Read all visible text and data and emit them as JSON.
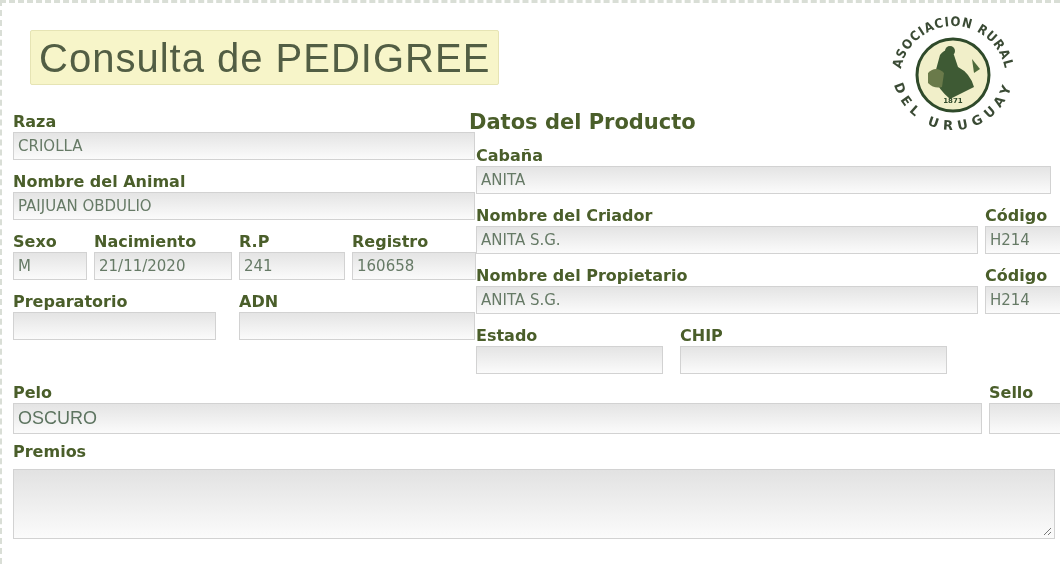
{
  "title": "Consulta de PEDIGREE",
  "logo": {
    "top_text": "ASOCIACION RURAL",
    "bottom_text": "DEL URUGUAY",
    "year": "1871"
  },
  "left_fields": [
    {
      "label": "Raza",
      "value": "CRIOLLA"
    },
    {
      "label": "Nombre del Animal",
      "value": "PAIJUAN OBDULIO"
    },
    {
      "label": "Sexo",
      "value": "M"
    },
    {
      "label": "Nacimiento",
      "value": "21/11/2020"
    },
    {
      "label": "R.P",
      "value": "241"
    },
    {
      "label": "Registro",
      "value": "160658"
    },
    {
      "label": "Preparatorio"
    },
    {
      "label": "ADN"
    }
  ],
  "product": {
    "heading": "Datos del Producto",
    "fields": [
      {
        "label": "Cabaña",
        "value": "ANITA"
      },
      {
        "label": "Nombre del Criador",
        "value": "ANITA S.G."
      },
      {
        "label": "Código",
        "value": "H214"
      },
      {
        "label": "Nombre del Propietario",
        "value": "ANITA S.G."
      },
      {
        "label": "Código",
        "value": "H214"
      },
      {
        "label": "Estado"
      },
      {
        "label": "CHIP"
      }
    ]
  },
  "bottom_fields": [
    {
      "label": "Pelo",
      "value": "OSCURO",
      "kind": "text"
    },
    {
      "label": "Sello",
      "kind": "text"
    },
    {
      "label": "Premios",
      "kind": "textarea"
    }
  ]
}
